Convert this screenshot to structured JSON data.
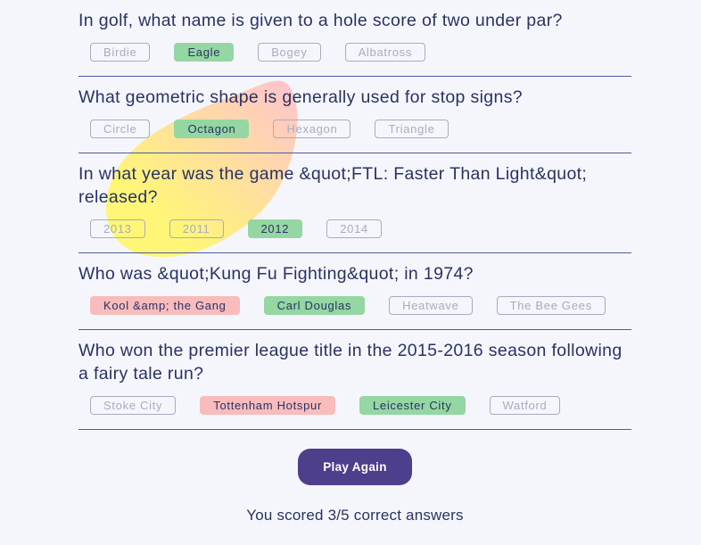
{
  "questions": [
    {
      "text": "In golf, what name is given to a hole score of two under par?",
      "answers": [
        {
          "label": "Birdie",
          "state": "neutral"
        },
        {
          "label": "Eagle",
          "state": "correct"
        },
        {
          "label": "Bogey",
          "state": "neutral"
        },
        {
          "label": "Albatross",
          "state": "neutral"
        }
      ]
    },
    {
      "text": "What geometric shape is generally used for stop signs?",
      "answers": [
        {
          "label": "Circle",
          "state": "neutral"
        },
        {
          "label": "Octagon",
          "state": "correct"
        },
        {
          "label": "Hexagon",
          "state": "neutral"
        },
        {
          "label": "Triangle",
          "state": "neutral"
        }
      ]
    },
    {
      "text": "In what year was the game &quot;FTL: Faster Than Light&quot; released?",
      "answers": [
        {
          "label": "2013",
          "state": "neutral"
        },
        {
          "label": "2011",
          "state": "neutral"
        },
        {
          "label": "2012",
          "state": "correct"
        },
        {
          "label": "2014",
          "state": "neutral"
        }
      ]
    },
    {
      "text": "Who was &quot;Kung Fu Fighting&quot; in 1974?",
      "answers": [
        {
          "label": "Kool &amp; the Gang",
          "state": "wrong"
        },
        {
          "label": "Carl Douglas",
          "state": "correct"
        },
        {
          "label": "Heatwave",
          "state": "neutral"
        },
        {
          "label": "The Bee Gees",
          "state": "neutral"
        }
      ]
    },
    {
      "text": "Who won the premier league title in the 2015-2016 season following a fairy tale run?",
      "answers": [
        {
          "label": "Stoke City",
          "state": "neutral"
        },
        {
          "label": "Tottenham Hotspur",
          "state": "wrong"
        },
        {
          "label": "Leicester City",
          "state": "correct"
        },
        {
          "label": "Watford",
          "state": "neutral"
        }
      ]
    }
  ],
  "play_again_label": "Play Again",
  "score_text": "You scored 3/5 correct answers",
  "colors": {
    "background": "#f5f6fb",
    "text": "#293264",
    "correct": "#94d7a2",
    "wrong": "#f8bcbc",
    "neutral": "#a7acbf",
    "button": "#4d3f8c",
    "divider": "#4d5b9e",
    "blob_start": "#fff677",
    "blob_end": "#ffc2cf"
  }
}
